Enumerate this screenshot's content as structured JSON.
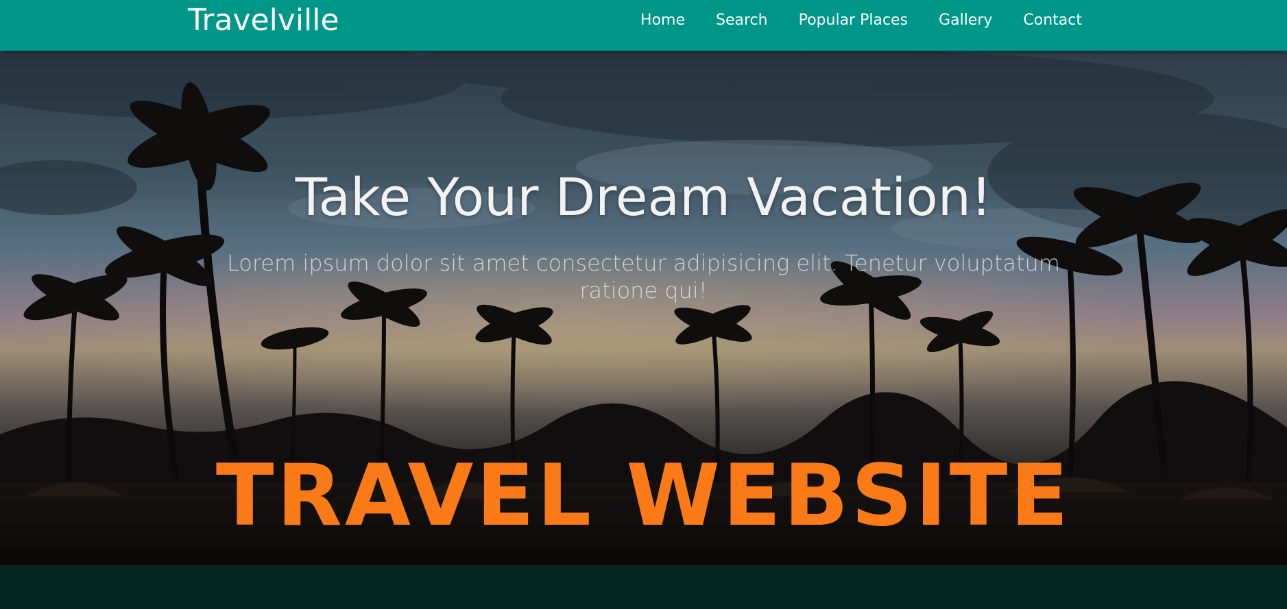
{
  "nav": {
    "brand": "Travelville",
    "links": [
      "Home",
      "Search",
      "Popular Places",
      "Gallery",
      "Contact"
    ]
  },
  "hero": {
    "title": "Take Your Dream Vacation!",
    "text": "Lorem ipsum dolor sit amet consectetur adipisicing elit. Tenetur voluptatum ratione qui!",
    "banner": "TRAVEL WEBSITE"
  },
  "colors": {
    "navbar": "#009688",
    "accent": "#fa7a17",
    "footer": "#032421"
  }
}
